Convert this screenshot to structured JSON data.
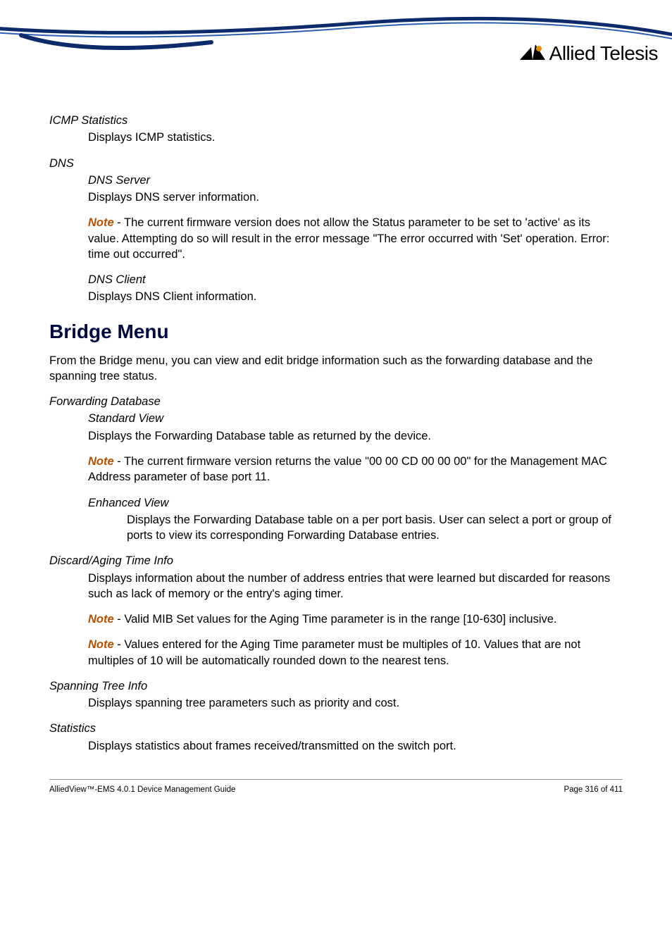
{
  "logo": {
    "text": "Allied Telesis"
  },
  "icmp": {
    "title": "ICMP Statistics",
    "desc": "Displays ICMP statistics."
  },
  "dns": {
    "title": "DNS",
    "server": {
      "title": "DNS Server",
      "desc": "Displays DNS server information."
    },
    "note": " - The current firmware version does not allow the Status parameter to be set to 'active' as its value. Attempting do so will result in the error message \"The error occurred with 'Set' operation. Error: time out occurred\".",
    "client": {
      "title": "DNS Client",
      "desc": "Displays DNS Client information."
    }
  },
  "bridge": {
    "heading": "Bridge Menu",
    "intro": "From the Bridge menu, you can view and edit bridge information such as the forwarding database and the spanning tree status."
  },
  "fdb": {
    "title": "Forwarding Database",
    "std": {
      "title": "Standard View",
      "desc": "Displays the Forwarding Database table as returned by the device."
    },
    "note": " - The current firmware version returns the value \"00 00 CD 00 00 00\" for the Management MAC Address parameter of base port 11.",
    "enh": {
      "title": "Enhanced View",
      "desc": "Displays the Forwarding Database table on a per port basis. User can select a port or group of ports to view its corresponding Forwarding Database entries."
    }
  },
  "discard": {
    "title": "Discard/Aging Time Info",
    "desc": "Displays information about the number of address entries that were learned but discarded for reasons such as lack of memory or the entry's aging timer.",
    "note1": " - Valid MIB Set values for the Aging Time parameter is in the range [10-630] inclusive.",
    "note2": " - Values entered for the Aging Time parameter must be multiples of 10. Values that are not multiples of 10 will be automatically rounded down to the nearest tens."
  },
  "spanning": {
    "title": "Spanning Tree Info",
    "desc": "Displays spanning tree parameters such as priority and cost."
  },
  "stats": {
    "title": "Statistics",
    "desc": "Displays statistics about frames received/transmitted on the switch port."
  },
  "footer": {
    "left": "AlliedView™-EMS 4.0.1 Device Management Guide",
    "right": "Page 316 of 411"
  },
  "labels": {
    "note": "Note"
  }
}
